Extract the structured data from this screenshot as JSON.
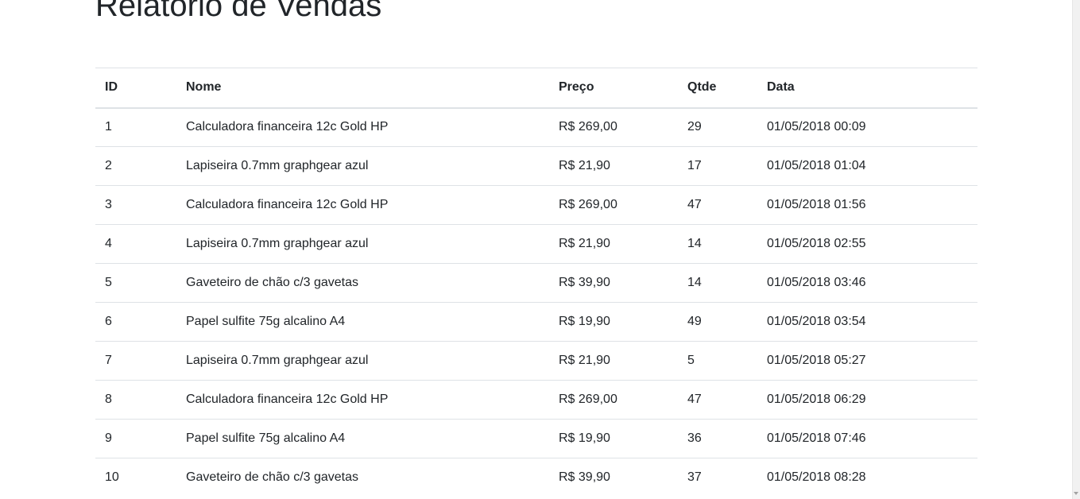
{
  "page": {
    "title": "Relatório de Vendas"
  },
  "table": {
    "headers": {
      "id": "ID",
      "nome": "Nome",
      "preco": "Preço",
      "qtde": "Qtde",
      "data": "Data"
    },
    "rows": [
      {
        "id": "1",
        "nome": "Calculadora financeira 12c Gold HP",
        "preco": "R$ 269,00",
        "qtde": "29",
        "data": "01/05/2018 00:09"
      },
      {
        "id": "2",
        "nome": "Lapiseira 0.7mm graphgear azul",
        "preco": "R$ 21,90",
        "qtde": "17",
        "data": "01/05/2018 01:04"
      },
      {
        "id": "3",
        "nome": "Calculadora financeira 12c Gold HP",
        "preco": "R$ 269,00",
        "qtde": "47",
        "data": "01/05/2018 01:56"
      },
      {
        "id": "4",
        "nome": "Lapiseira 0.7mm graphgear azul",
        "preco": "R$ 21,90",
        "qtde": "14",
        "data": "01/05/2018 02:55"
      },
      {
        "id": "5",
        "nome": "Gaveteiro de chão c/3 gavetas",
        "preco": "R$ 39,90",
        "qtde": "14",
        "data": "01/05/2018 03:46"
      },
      {
        "id": "6",
        "nome": "Papel sulfite 75g alcalino A4",
        "preco": "R$ 19,90",
        "qtde": "49",
        "data": "01/05/2018 03:54"
      },
      {
        "id": "7",
        "nome": "Lapiseira 0.7mm graphgear azul",
        "preco": "R$ 21,90",
        "qtde": "5",
        "data": "01/05/2018 05:27"
      },
      {
        "id": "8",
        "nome": "Calculadora financeira 12c Gold HP",
        "preco": "R$ 269,00",
        "qtde": "47",
        "data": "01/05/2018 06:29"
      },
      {
        "id": "9",
        "nome": "Papel sulfite 75g alcalino A4",
        "preco": "R$ 19,90",
        "qtde": "36",
        "data": "01/05/2018 07:46"
      },
      {
        "id": "10",
        "nome": "Gaveteiro de chão c/3 gavetas",
        "preco": "R$ 39,90",
        "qtde": "37",
        "data": "01/05/2018 08:28"
      }
    ]
  },
  "scrollbar": {
    "arrow_icon": "chevron-down-icon"
  }
}
